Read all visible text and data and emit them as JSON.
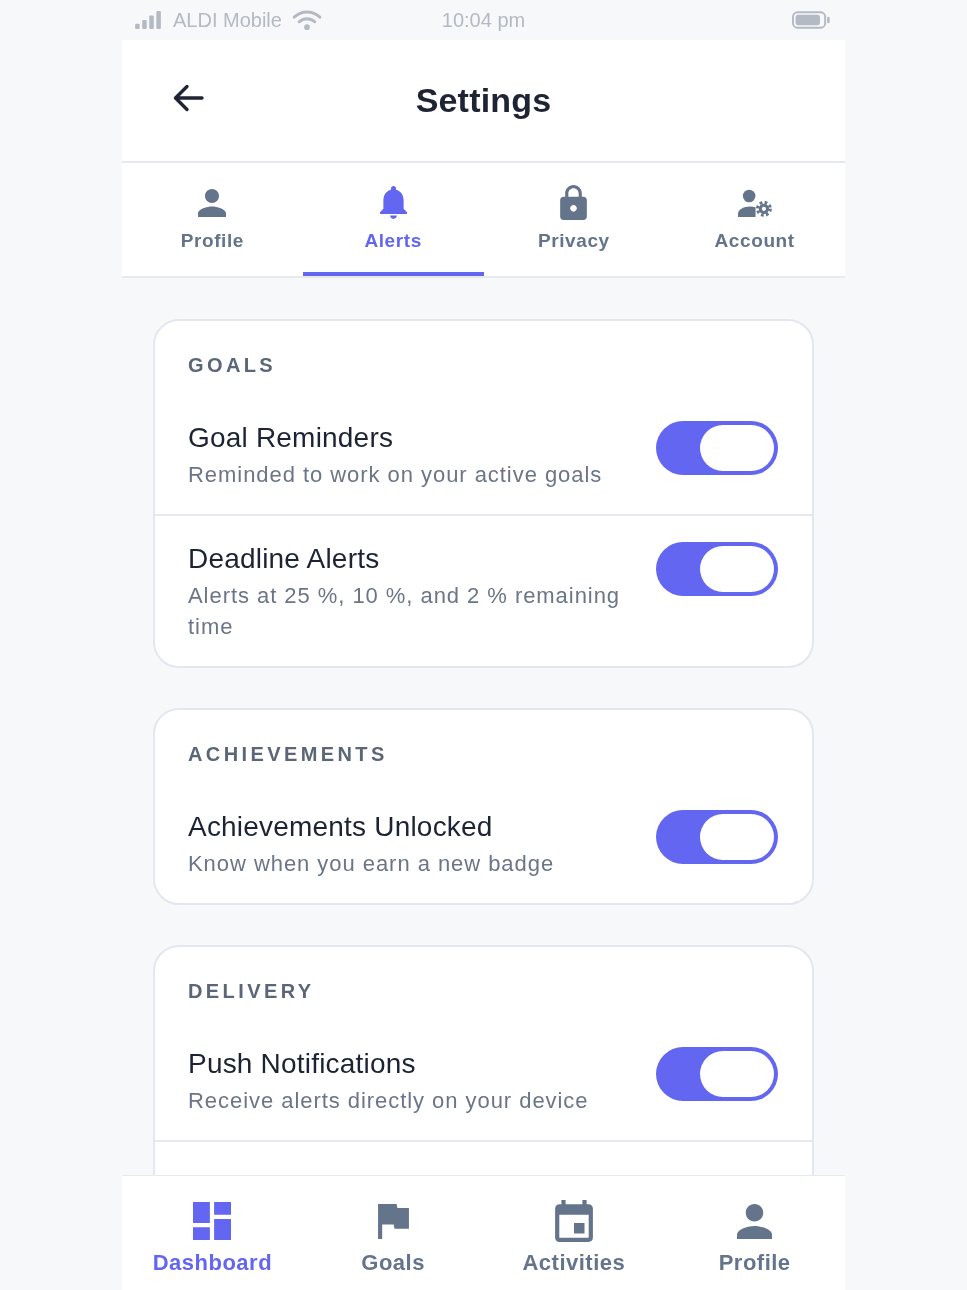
{
  "status_bar": {
    "carrier": "ALDI Mobile",
    "time": "10:04 pm"
  },
  "header": {
    "title": "Settings"
  },
  "tabs": [
    {
      "label": "Profile",
      "selected": false
    },
    {
      "label": "Alerts",
      "selected": true
    },
    {
      "label": "Privacy",
      "selected": false
    },
    {
      "label": "Account",
      "selected": false
    }
  ],
  "sections": [
    {
      "heading": "GOALS",
      "items": [
        {
          "title": "Goal Reminders",
          "subtitle": "Reminded to work on your active goals",
          "on": true
        },
        {
          "title": "Deadline Alerts",
          "subtitle": "Alerts at 25 %, 10 %, and 2 % remaining time",
          "on": true
        }
      ]
    },
    {
      "heading": "ACHIEVEMENTS",
      "items": [
        {
          "title": "Achievements Unlocked",
          "subtitle": "Know when you earn a new badge",
          "on": true
        }
      ]
    },
    {
      "heading": "DELIVERY",
      "items": [
        {
          "title": "Push Notifications",
          "subtitle": "Receive alerts directly on your device",
          "on": true
        }
      ]
    }
  ],
  "bottom_nav": [
    {
      "label": "Dashboard",
      "selected": true
    },
    {
      "label": "Goals",
      "selected": false
    },
    {
      "label": "Activities",
      "selected": false
    },
    {
      "label": "Profile",
      "selected": false
    }
  ]
}
